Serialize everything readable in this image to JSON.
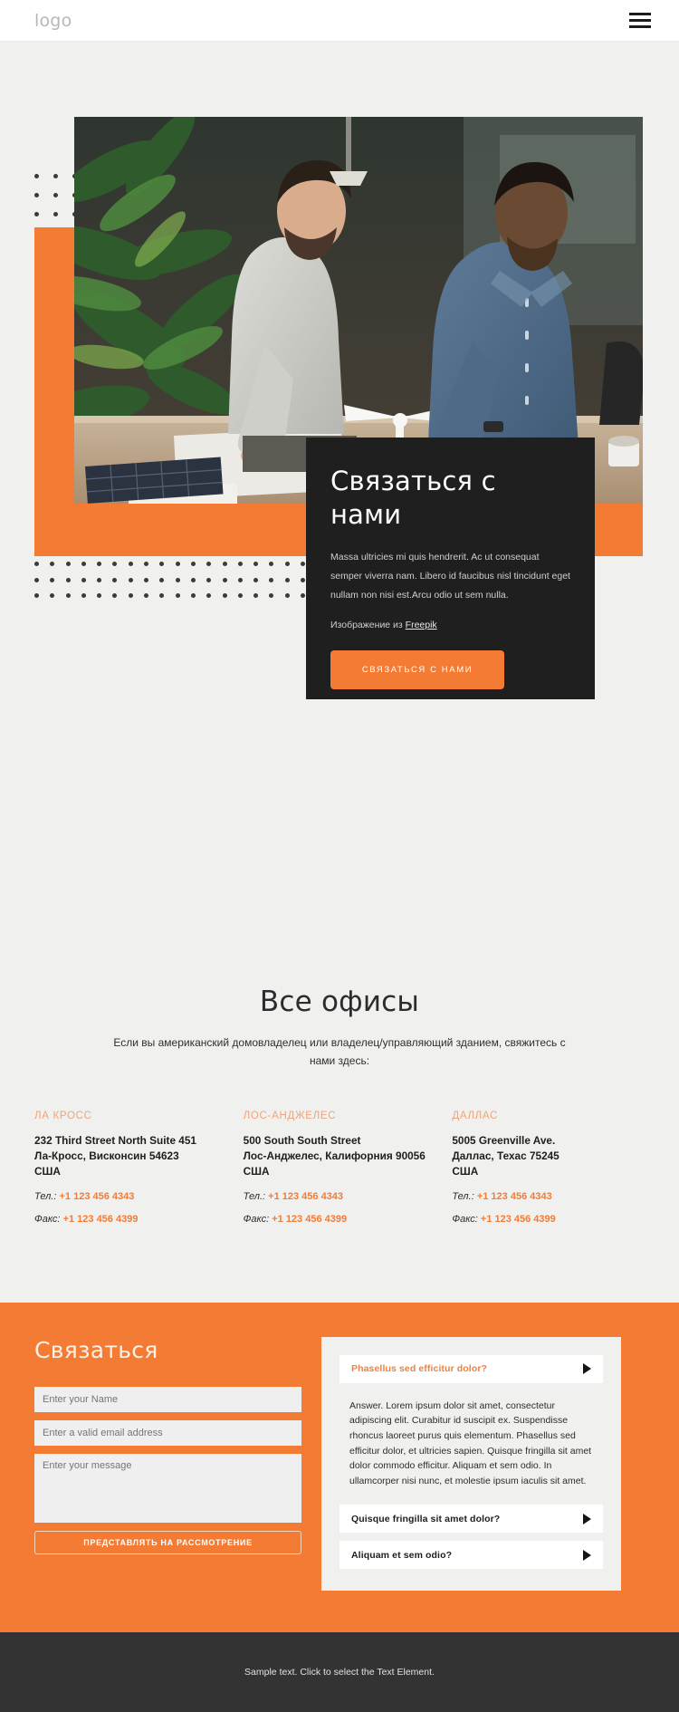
{
  "header": {
    "logo": "logo",
    "menu_icon": "hamburger-menu-icon"
  },
  "hero": {
    "card": {
      "title": "Связаться с нами",
      "body": "Massa ultricies mi quis hendrerit. Ac ut consequat semper viverra nam. Libero id faucibus nisl tincidunt eget nullam non nisi est.Arcu odio ut sem nulla.",
      "credit_prefix": "Изображение из ",
      "credit_link": "Freepik",
      "cta_label": "СВЯЗАТЬСЯ С НАМИ"
    }
  },
  "offices": {
    "title": "Все офисы",
    "subtitle": "Если вы американский домовладелец или владелец/управляющий зданием, свяжитесь с нами здесь:",
    "items": [
      {
        "name": "ЛА КРОСС",
        "address_line1": "232 Third Street North Suite 451",
        "address_line2": "Ла-Кросс, Висконсин 54623",
        "address_line3": "США",
        "phone_label": "Тел.:",
        "phone": "+1 123 456 4343",
        "fax_label": "Факс:",
        "fax": "+1 123 456 4399"
      },
      {
        "name": "ЛОС-АНДЖЕЛЕС",
        "address_line1": "500 South South Street",
        "address_line2": "Лос-Анджелес, Калифорния 90056",
        "address_line3": "США",
        "phone_label": "Тел.:",
        "phone": "+1 123 456 4343",
        "fax_label": "Факс:",
        "fax": "+1 123 456 4399"
      },
      {
        "name": "ДАЛЛАС",
        "address_line1": "5005 Greenville Ave.",
        "address_line2": "Даллас, Техас 75245",
        "address_line3": "США",
        "phone_label": "Тел.:",
        "phone": "+1 123 456 4343",
        "fax_label": "Факс:",
        "fax": "+1 123 456 4399"
      }
    ]
  },
  "contact_form": {
    "title": "Связаться",
    "name_placeholder": "Enter your Name",
    "name_value": "",
    "email_placeholder": "Enter a valid email address",
    "email_value": "",
    "message_placeholder": "Enter your message",
    "message_value": "",
    "submit_label": "ПРЕДСТАВЛЯТЬ НА РАССМОТРЕНИЕ"
  },
  "faq": {
    "items": [
      {
        "question": "Phasellus sed efficitur dolor?",
        "answer": "Answer. Lorem ipsum dolor sit amet, consectetur adipiscing elit. Curabitur id suscipit ex. Suspendisse rhoncus laoreet purus quis elementum. Phasellus sed efficitur dolor, et ultricies sapien. Quisque fringilla sit amet dolor commodo efficitur. Aliquam et sem odio. In ullamcorper nisi nunc, et molestie ipsum iaculis sit amet.",
        "open": true
      },
      {
        "question": "Quisque fringilla sit amet dolor?",
        "answer": "",
        "open": false
      },
      {
        "question": "Aliquam et sem odio?",
        "answer": "",
        "open": false
      }
    ]
  },
  "footer": {
    "text": "Sample text. Click to select the Text Element."
  },
  "colors": {
    "accent": "#f47b33",
    "dark_card": "#1f1f1f",
    "page_bg": "#f0f0ef",
    "footer_bg": "#333333",
    "office_heading": "#f0a377"
  }
}
